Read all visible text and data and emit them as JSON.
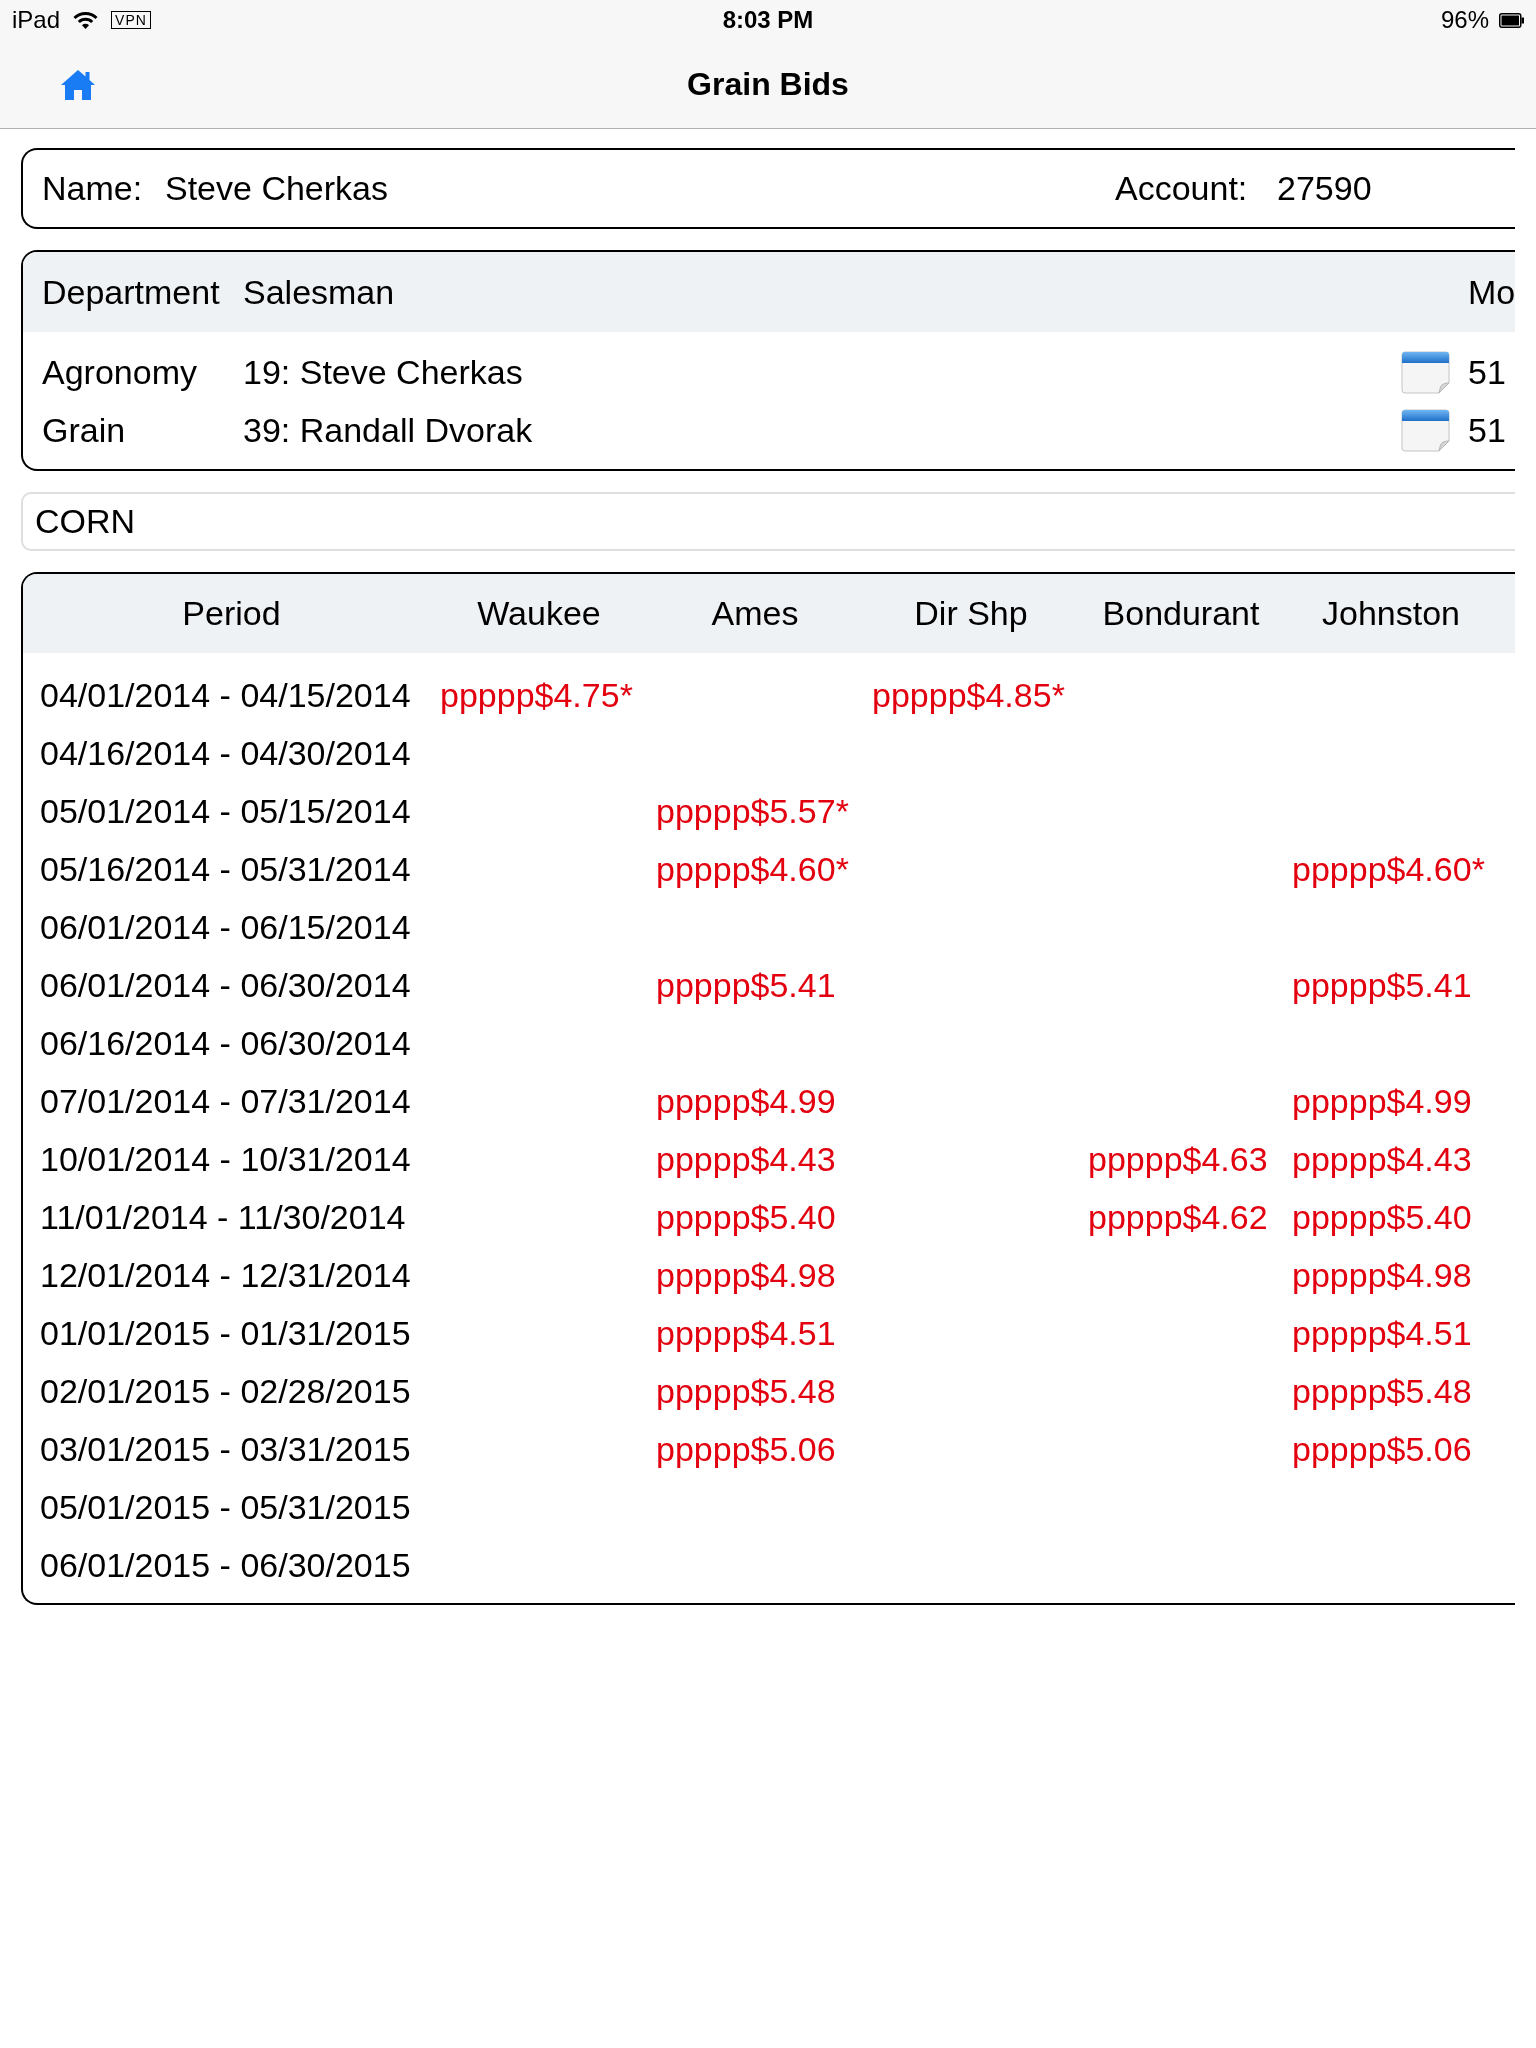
{
  "status_bar": {
    "device": "iPad",
    "vpn": "VPN",
    "time": "8:03 PM",
    "battery": "96%"
  },
  "nav_bar": {
    "title": "Grain Bids"
  },
  "customer": {
    "name_label": "Name:",
    "name": "Steve Cherkas",
    "account_label": "Account:",
    "account": "27590"
  },
  "contacts": {
    "columns": [
      "Department",
      "Salesman",
      "Mo"
    ],
    "rows": [
      {
        "department": "Agronomy",
        "salesman": "19: Steve Cherkas",
        "column_3": "51"
      },
      {
        "department": "Grain",
        "salesman": "39: Randall Dvorak",
        "column_3": "51"
      }
    ]
  },
  "commodity": {
    "value": "CORN"
  },
  "bids_table": {
    "columns": [
      "Period",
      "Waukee",
      "Ames",
      "Dir Shp",
      "Bondurant",
      "Johnston"
    ],
    "rows": [
      {
        "period": "04/01/2014 - 04/15/2014",
        "waukee": "ppppp$4.75*",
        "dir_shp": "ppppp$4.85*"
      },
      {
        "period": "04/16/2014 - 04/30/2014"
      },
      {
        "period": "05/01/2014 - 05/15/2014",
        "ames": "ppppp$5.57*"
      },
      {
        "period": "05/16/2014 - 05/31/2014",
        "ames": "ppppp$4.60*",
        "johnston": "ppppp$4.60*"
      },
      {
        "period": "06/01/2014 - 06/15/2014"
      },
      {
        "period": "06/01/2014 - 06/30/2014",
        "ames": "ppppp$5.41",
        "johnston": "ppppp$5.41"
      },
      {
        "period": "06/16/2014 - 06/30/2014"
      },
      {
        "period": "07/01/2014 - 07/31/2014",
        "ames": "ppppp$4.99",
        "johnston": "ppppp$4.99"
      },
      {
        "period": "10/01/2014 - 10/31/2014",
        "ames": "ppppp$4.43",
        "bondurant": "ppppp$4.63",
        "johnston": "ppppp$4.43"
      },
      {
        "period": "11/01/2014 - 11/30/2014",
        "ames": "ppppp$5.40",
        "bondurant": "ppppp$4.62",
        "johnston": "ppppp$5.40"
      },
      {
        "period": "12/01/2014 - 12/31/2014",
        "ames": "ppppp$4.98",
        "johnston": "ppppp$4.98"
      },
      {
        "period": "01/01/2015 - 01/31/2015",
        "ames": "ppppp$4.51",
        "johnston": "ppppp$4.51"
      },
      {
        "period": "02/01/2015 - 02/28/2015",
        "ames": "ppppp$5.48",
        "johnston": "ppppp$5.48"
      },
      {
        "period": "03/01/2015 - 03/31/2015",
        "ames": "ppppp$5.06",
        "johnston": "ppppp$5.06"
      },
      {
        "period": "05/01/2015 - 05/31/2015"
      },
      {
        "period": "06/01/2015 - 06/30/2015"
      }
    ]
  }
}
